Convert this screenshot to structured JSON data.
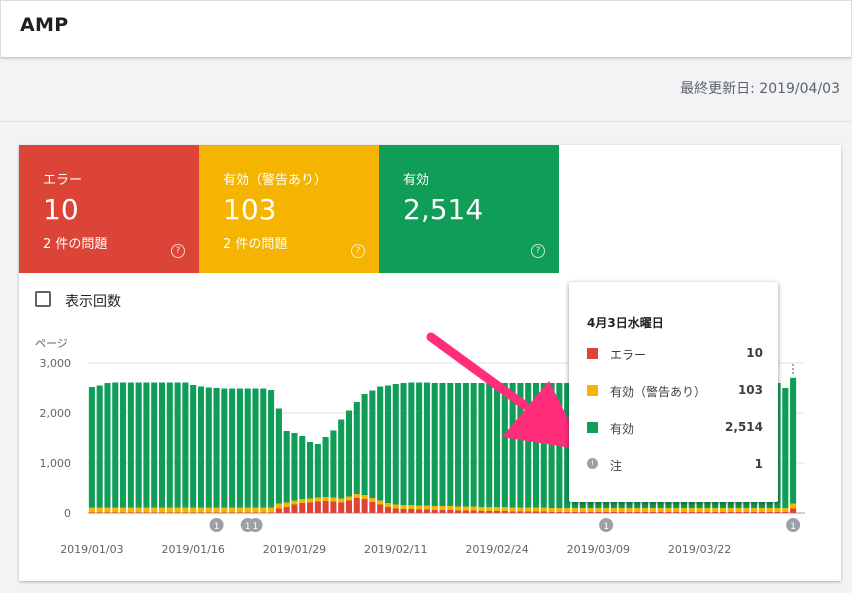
{
  "header": {
    "title": "AMP"
  },
  "last_updated": "最終更新日: 2019/04/03",
  "colors": {
    "error": "#db4437",
    "warning": "#f4b400",
    "valid": "#0f9d58",
    "annotation": "#9aa0a6"
  },
  "tiles": [
    {
      "label": "エラー",
      "value": "10",
      "sub": "2 件の問題",
      "help": "?"
    },
    {
      "label": "有効（警告あり）",
      "value": "103",
      "sub": "2 件の問題",
      "help": "?"
    },
    {
      "label": "有効",
      "value": "2,514",
      "help": "?"
    }
  ],
  "impressions_toggle": {
    "label": "表示回数",
    "checked": false
  },
  "tooltip": {
    "date": "4月3日水曜日",
    "rows": [
      {
        "name": "エラー",
        "value": "10"
      },
      {
        "name": "有効（警告あり）",
        "value": "103"
      },
      {
        "name": "有効",
        "value": "2,514"
      },
      {
        "name": "注",
        "value": "1"
      }
    ]
  },
  "chart_data": {
    "type": "bar",
    "stacked": true,
    "ylabel": "ページ",
    "ylim": [
      0,
      3000
    ],
    "yticks": [
      "0",
      "1,000",
      "2,000",
      "3,000"
    ],
    "x_tick_labels": [
      "2019/01/03",
      "2019/01/16",
      "2019/01/29",
      "2019/02/11",
      "2019/02/24",
      "2019/03/09",
      "2019/03/22"
    ],
    "grid": true,
    "start_date": "2019/01/03",
    "end_date": "2019/04/03",
    "series": [
      {
        "name": "エラー",
        "values": [
          10,
          10,
          10,
          10,
          10,
          10,
          10,
          10,
          10,
          10,
          10,
          10,
          10,
          10,
          10,
          10,
          10,
          10,
          10,
          10,
          10,
          10,
          10,
          10,
          90,
          120,
          170,
          200,
          210,
          230,
          240,
          230,
          210,
          250,
          300,
          280,
          220,
          170,
          120,
          90,
          80,
          80,
          70,
          70,
          60,
          60,
          60,
          50,
          50,
          50,
          40,
          40,
          40,
          40,
          30,
          30,
          30,
          30,
          30,
          20,
          20,
          20,
          20,
          20,
          20,
          20,
          20,
          20,
          20,
          20,
          20,
          20,
          20,
          20,
          20,
          20,
          20,
          20,
          20,
          20,
          20,
          20,
          20,
          20,
          20,
          20,
          20,
          20,
          20,
          20,
          90
        ]
      },
      {
        "name": "有効（警告あり）",
        "values": [
          100,
          100,
          100,
          100,
          100,
          100,
          100,
          100,
          100,
          100,
          100,
          100,
          100,
          100,
          100,
          100,
          100,
          100,
          100,
          100,
          100,
          100,
          100,
          100,
          100,
          90,
          80,
          80,
          80,
          80,
          80,
          80,
          80,
          80,
          80,
          80,
          80,
          80,
          80,
          80,
          80,
          80,
          80,
          80,
          80,
          80,
          80,
          80,
          80,
          80,
          80,
          80,
          80,
          80,
          80,
          80,
          80,
          80,
          80,
          80,
          80,
          80,
          80,
          80,
          80,
          80,
          80,
          80,
          80,
          80,
          80,
          80,
          80,
          80,
          80,
          80,
          80,
          80,
          80,
          80,
          80,
          80,
          80,
          80,
          80,
          80,
          80,
          80,
          80,
          80,
          100
        ]
      },
      {
        "name": "有効",
        "values": [
          2410,
          2440,
          2490,
          2500,
          2500,
          2500,
          2500,
          2500,
          2500,
          2500,
          2500,
          2500,
          2500,
          2450,
          2420,
          2400,
          2390,
          2380,
          2380,
          2380,
          2380,
          2380,
          2380,
          2350,
          1900,
          1430,
          1350,
          1260,
          1130,
          1070,
          1200,
          1340,
          1580,
          1720,
          1840,
          2020,
          2150,
          2280,
          2350,
          2410,
          2440,
          2450,
          2460,
          2460,
          2460,
          2460,
          2460,
          2470,
          2470,
          2470,
          2480,
          2480,
          2480,
          2480,
          2490,
          2490,
          2490,
          2490,
          2490,
          2500,
          2500,
          2500,
          2500,
          2500,
          2500,
          2500,
          2500,
          2500,
          2500,
          2500,
          2500,
          2500,
          2500,
          2500,
          2500,
          2500,
          2500,
          2500,
          2500,
          2500,
          2500,
          2500,
          2500,
          2500,
          2500,
          2500,
          2500,
          2500,
          2500,
          2400,
          2514
        ]
      }
    ],
    "annotations": [
      {
        "date": "2019/01/19",
        "count": "1"
      },
      {
        "date": "2019/01/23",
        "count": "1"
      },
      {
        "date": "2019/01/24",
        "count": "1"
      },
      {
        "date": "2019/03/10",
        "count": "1"
      },
      {
        "date": "2019/04/03",
        "count": "1"
      }
    ]
  }
}
